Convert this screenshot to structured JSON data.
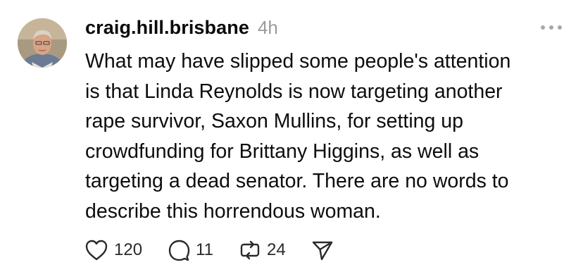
{
  "post": {
    "author": {
      "username": "craig.hill.brisbane",
      "avatar_icon": "profile-photo"
    },
    "timestamp": "4h",
    "more_icon": "more-horizontal-icon",
    "body": "What may have slipped some people's attention\nis that Linda Reynolds is now targeting another\nrape survivor, Saxon Mullins, for setting up\ncrowdfunding for Brittany Higgins, as well as\ntargeting a dead senator. There are no words to\ndescribe this horrendous woman.",
    "actions": {
      "likes": {
        "icon": "heart-icon",
        "count": "120"
      },
      "replies": {
        "icon": "comment-icon",
        "count": "11"
      },
      "reposts": {
        "icon": "repost-icon",
        "count": "24"
      },
      "share": {
        "icon": "send-icon"
      }
    }
  },
  "colors": {
    "text": "#0d0d0d",
    "muted": "#9a9a9a",
    "icon": "#2a2a2a",
    "background": "#ffffff"
  }
}
